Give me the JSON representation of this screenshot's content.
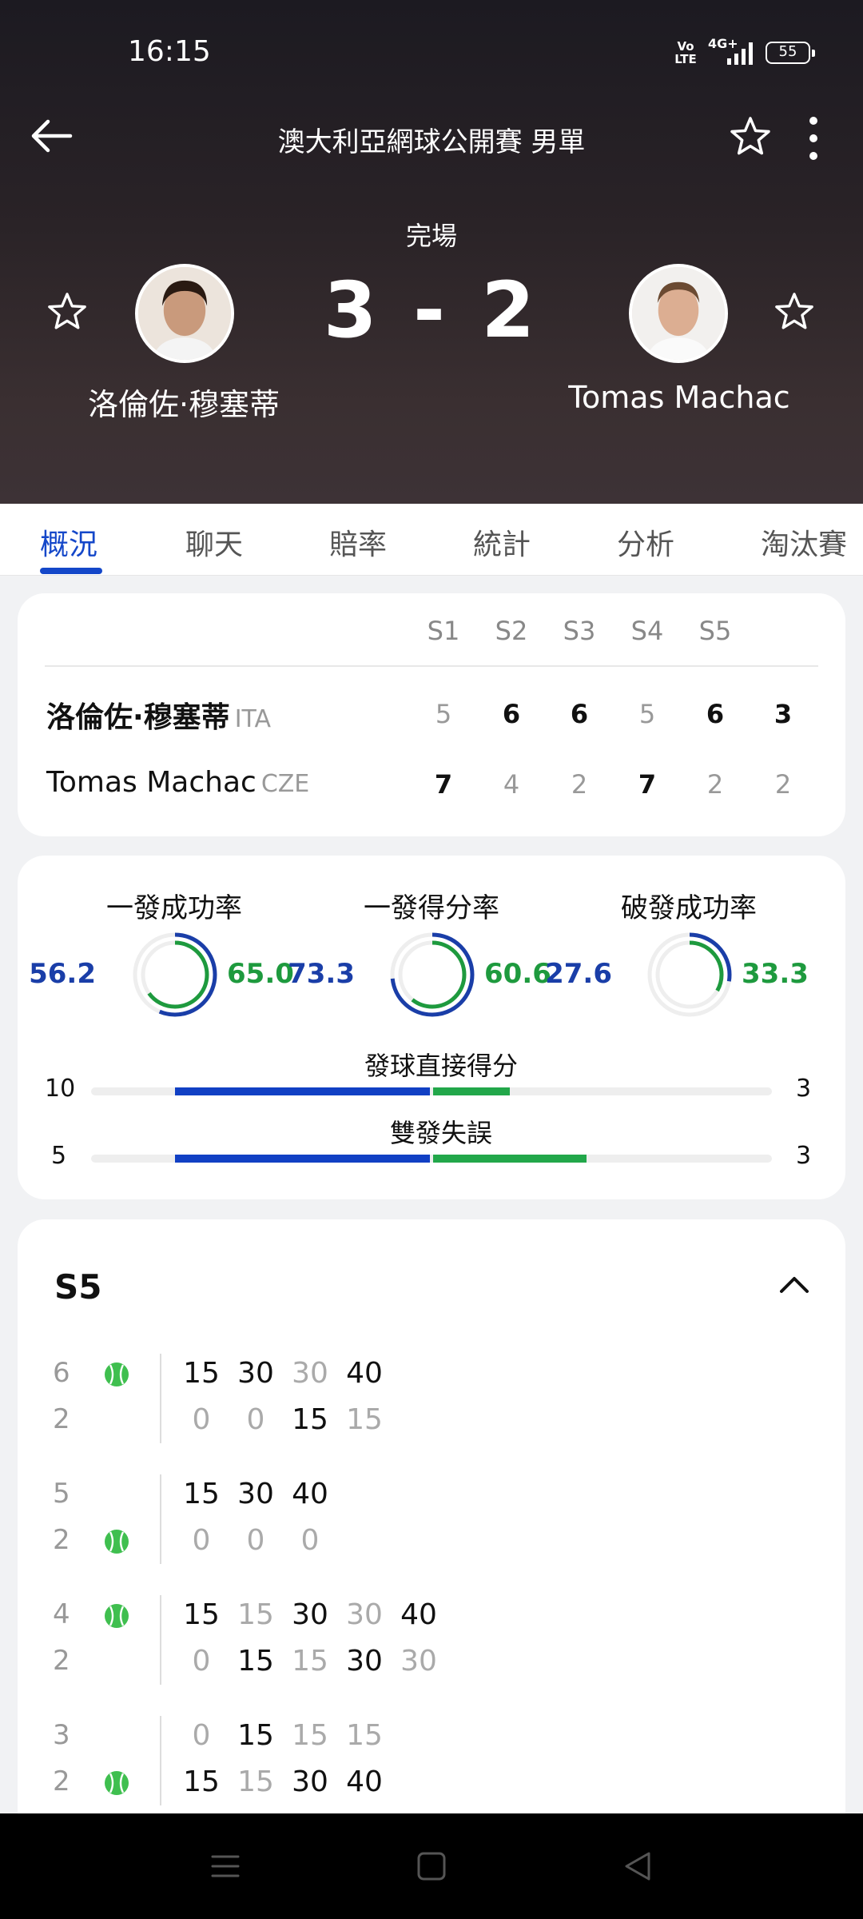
{
  "status_bar": {
    "time": "16:15",
    "volte": "Vo LTE",
    "network": "4G+",
    "battery": "55"
  },
  "header": {
    "title": "澳大利亞網球公開賽 男單",
    "status": "完場",
    "score": "3 - 2"
  },
  "players": {
    "left": {
      "name": "洛倫佐·穆塞蒂",
      "country": "ITA"
    },
    "right": {
      "name": "Tomas Machac",
      "country": "CZE"
    }
  },
  "tabs": [
    "概況",
    "聊天",
    "賠率",
    "統計",
    "分析",
    "淘汰賽"
  ],
  "scoreboard": {
    "headers": [
      "S1",
      "S2",
      "S3",
      "S4",
      "S5"
    ],
    "rows": [
      {
        "name": "洛倫佐·穆塞蒂",
        "country": "ITA",
        "sets": [
          "5",
          "6",
          "6",
          "5",
          "6"
        ],
        "current": "3"
      },
      {
        "name": "Tomas Machac",
        "country": "CZE",
        "sets": [
          "7",
          "4",
          "2",
          "7",
          "2"
        ],
        "current": "2"
      }
    ]
  },
  "stats": {
    "rings": [
      {
        "title": "一發成功率",
        "left": "56.2",
        "right": "65.0",
        "left_pct": 56.2,
        "right_pct": 65.0
      },
      {
        "title": "一發得分率",
        "left": "73.3",
        "right": "60.6",
        "left_pct": 73.3,
        "right_pct": 60.6
      },
      {
        "title": "破發成功率",
        "left": "27.6",
        "right": "33.3",
        "left_pct": 27.6,
        "right_pct": 33.3
      }
    ],
    "bars": [
      {
        "title": "發球直接得分",
        "left": "10",
        "right": "3",
        "left_val": 10,
        "right_val": 3
      },
      {
        "title": "雙發失誤",
        "left": "5",
        "right": "3",
        "left_val": 5,
        "right_val": 3
      }
    ]
  },
  "set_detail": {
    "title": "S5",
    "games": [
      {
        "top": "6",
        "bottom": "2",
        "server": "top",
        "top_pts": [
          "15",
          "30",
          "30",
          "40"
        ],
        "bottom_pts": [
          "0",
          "0",
          "15",
          "15"
        ]
      },
      {
        "top": "5",
        "bottom": "2",
        "server": "bottom",
        "top_pts": [
          "15",
          "30",
          "40"
        ],
        "bottom_pts": [
          "0",
          "0",
          "0"
        ]
      },
      {
        "top": "4",
        "bottom": "2",
        "server": "top",
        "top_pts": [
          "15",
          "15",
          "30",
          "30",
          "40"
        ],
        "bottom_pts": [
          "0",
          "15",
          "15",
          "30",
          "30"
        ]
      },
      {
        "top": "3",
        "bottom": "2",
        "server": "bottom",
        "top_pts": [
          "0",
          "15",
          "15",
          "15"
        ],
        "bottom_pts": [
          "15",
          "15",
          "30",
          "40"
        ]
      }
    ]
  },
  "colors": {
    "accent": "#1447c9",
    "player_left": "#1a3ea8",
    "player_right": "#1e9a3e"
  }
}
